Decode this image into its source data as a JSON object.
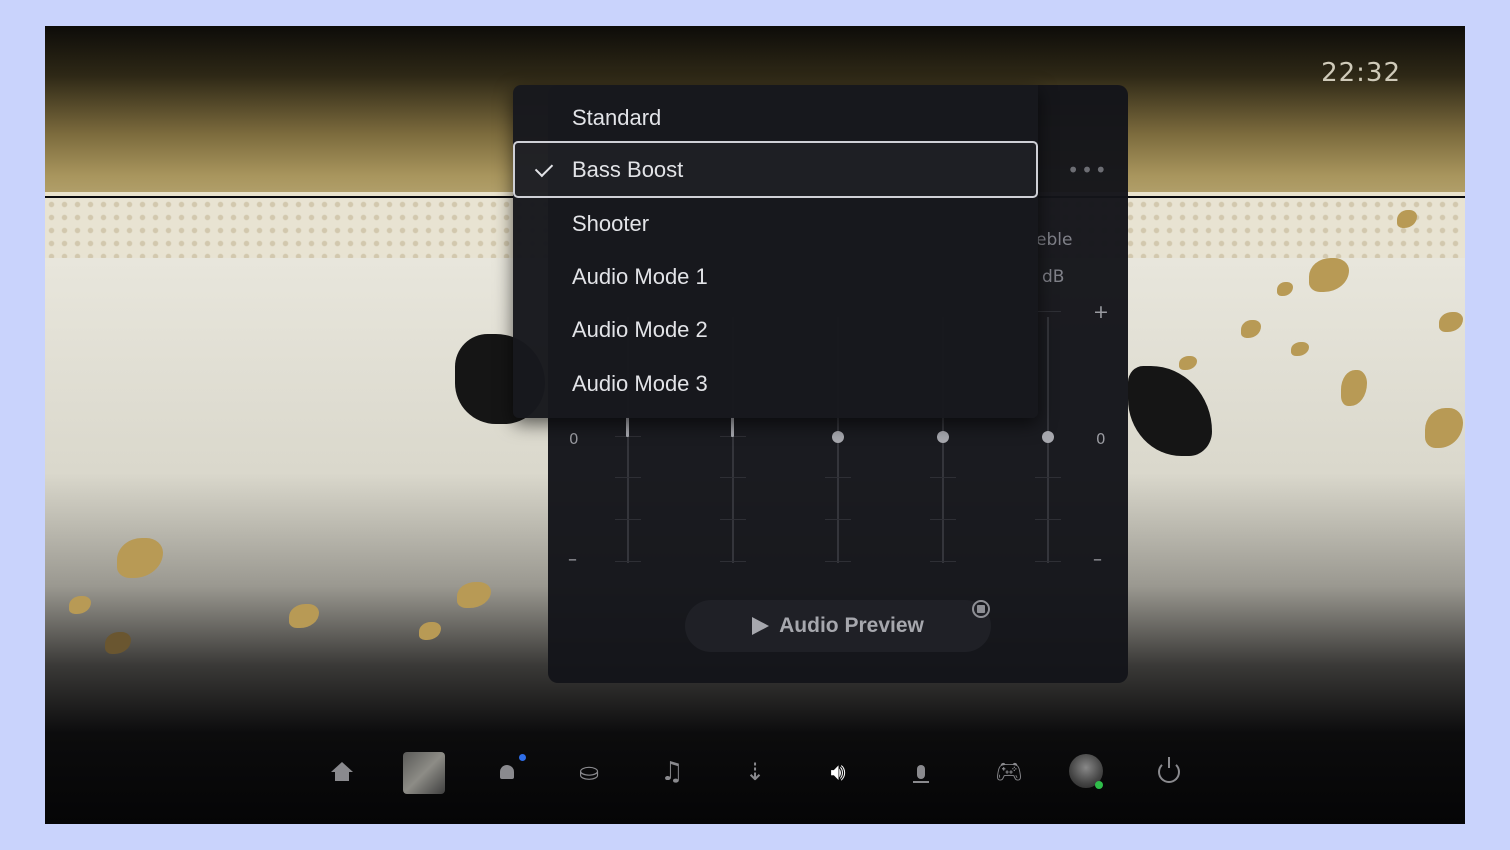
{
  "status": {
    "clock": "22:32"
  },
  "equalizer": {
    "partial_label_treble": "eble",
    "partial_label_db": "dB",
    "scale_plus": "+",
    "scale_zero": "0",
    "scale_minus": "–",
    "more_icon": "more-icon",
    "preview_button_label": "Audio Preview",
    "preview_icon": "play-icon",
    "stop_icon": "stop-icon"
  },
  "preset_menu": {
    "selected": "Bass Boost",
    "items": [
      {
        "label": "Standard",
        "selected": false
      },
      {
        "label": "Bass Boost",
        "selected": true
      },
      {
        "label": "Shooter",
        "selected": false
      },
      {
        "label": "Audio Mode 1",
        "selected": false
      },
      {
        "label": "Audio Mode 2",
        "selected": false
      },
      {
        "label": "Audio Mode 3",
        "selected": false
      }
    ]
  },
  "control_center": {
    "items": [
      {
        "name": "home",
        "icon": "home-icon",
        "active": false
      },
      {
        "name": "game",
        "icon": "game-thumbnail",
        "active": false
      },
      {
        "name": "notifications",
        "icon": "bell-icon",
        "active": false
      },
      {
        "name": "game-base",
        "icon": "friends-icon",
        "active": false
      },
      {
        "name": "music",
        "icon": "music-icon",
        "active": false
      },
      {
        "name": "accessibility",
        "icon": "accessibility-icon",
        "active": false
      },
      {
        "name": "sound",
        "icon": "speaker-icon",
        "active": true
      },
      {
        "name": "mic",
        "icon": "mic-icon",
        "active": false
      },
      {
        "name": "accessories",
        "icon": "controller-icon",
        "active": false
      },
      {
        "name": "profile",
        "icon": "avatar",
        "active": false
      },
      {
        "name": "power",
        "icon": "power-icon",
        "active": false
      }
    ]
  },
  "colors": {
    "panel": "#14151a",
    "menu": "#17181e",
    "menu_text": "#e2e3e7",
    "selected_outline": "#cfd0d6",
    "notification": "#2f6ee8",
    "online": "#2fbd4a",
    "page_background": "#c9d3fc"
  }
}
